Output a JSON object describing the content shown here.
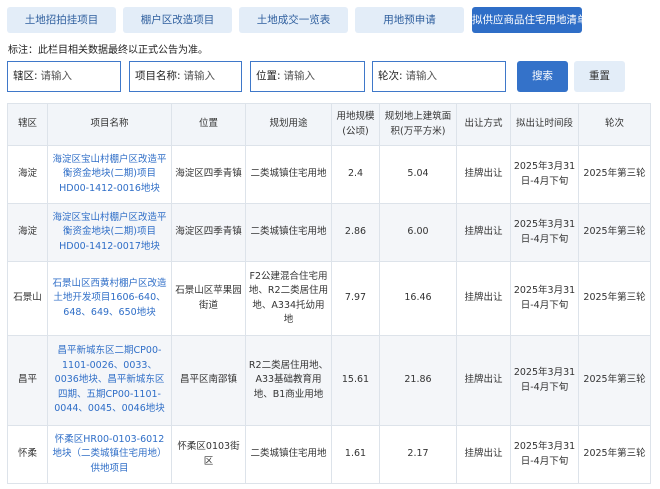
{
  "tabs": [
    {
      "label": "土地招拍挂项目",
      "active": false
    },
    {
      "label": "棚户区改造项目",
      "active": false
    },
    {
      "label": "土地成交一览表",
      "active": false
    },
    {
      "label": "用地预申请",
      "active": false
    },
    {
      "label": "拟供应商品住宅用地清单",
      "active": true
    }
  ],
  "note": "标注：此栏目相关数据最终以正式公告为准。",
  "filters": {
    "district": {
      "label": "辖区:",
      "placeholder": "请输入"
    },
    "project": {
      "label": "项目名称:",
      "placeholder": "请输入"
    },
    "location": {
      "label": "位置:",
      "placeholder": "请输入"
    },
    "round": {
      "label": "轮次:",
      "placeholder": "请输入"
    },
    "search_label": "搜索",
    "reset_label": "重置"
  },
  "table": {
    "headers": [
      "辖区",
      "项目名称",
      "位置",
      "规划用途",
      "用地规模(公顷)",
      "规划地上建筑面积(万平方米)",
      "出让方式",
      "拟出让时间段",
      "轮次"
    ],
    "rows": [
      {
        "district": "海淀",
        "name": "海淀区宝山村棚户区改造平衡资金地块(二期)项目HD00-1412-0016地块",
        "location": "海淀区四季青镇",
        "use": "二类城镇住宅用地",
        "area": "2.4",
        "building": "5.04",
        "method": "挂牌出让",
        "period": "2025年3月31日-4月下旬",
        "round": "2025年第三轮"
      },
      {
        "district": "海淀",
        "name": "海淀区宝山村棚户区改造平衡资金地块(二期)项目HD00-1412-0017地块",
        "location": "海淀区四季青镇",
        "use": "二类城镇住宅用地",
        "area": "2.86",
        "building": "6.00",
        "method": "挂牌出让",
        "period": "2025年3月31日-4月下旬",
        "round": "2025年第三轮"
      },
      {
        "district": "石景山",
        "name": "石景山区西黄村棚户区改造土地开发项目1606-640、648、649、650地块",
        "location": "石景山区苹果园街道",
        "use": "F2公建混合住宅用地、R2二类居住用地、A334托幼用地",
        "area": "7.97",
        "building": "16.46",
        "method": "挂牌出让",
        "period": "2025年3月31日-4月下旬",
        "round": "2025年第三轮"
      },
      {
        "district": "昌平",
        "name": "昌平新城东区二期CP00-1101-0026、0033、0036地块、昌平新城东区四期、五期CP00-1101-0044、0045、0046地块",
        "location": "昌平区南邵镇",
        "use": "R2二类居住用地、A33基础教育用地、B1商业用地",
        "area": "15.61",
        "building": "21.86",
        "method": "挂牌出让",
        "period": "2025年3月31日-4月下旬",
        "round": "2025年第三轮"
      },
      {
        "district": "怀柔",
        "name": "怀柔区HR00-0103-6012地块（二类城镇住宅用地）供地项目",
        "location": "怀柔区0103街区",
        "use": "二类城镇住宅用地",
        "area": "1.61",
        "building": "2.17",
        "method": "挂牌出让",
        "period": "2025年3月31日-4月下旬",
        "round": "2025年第三轮"
      }
    ]
  },
  "colors": {
    "accent": "#2f6ec7",
    "tab_bg": "#e3edf8",
    "header_bg": "#f2f5f9",
    "border": "#dde3ea"
  }
}
